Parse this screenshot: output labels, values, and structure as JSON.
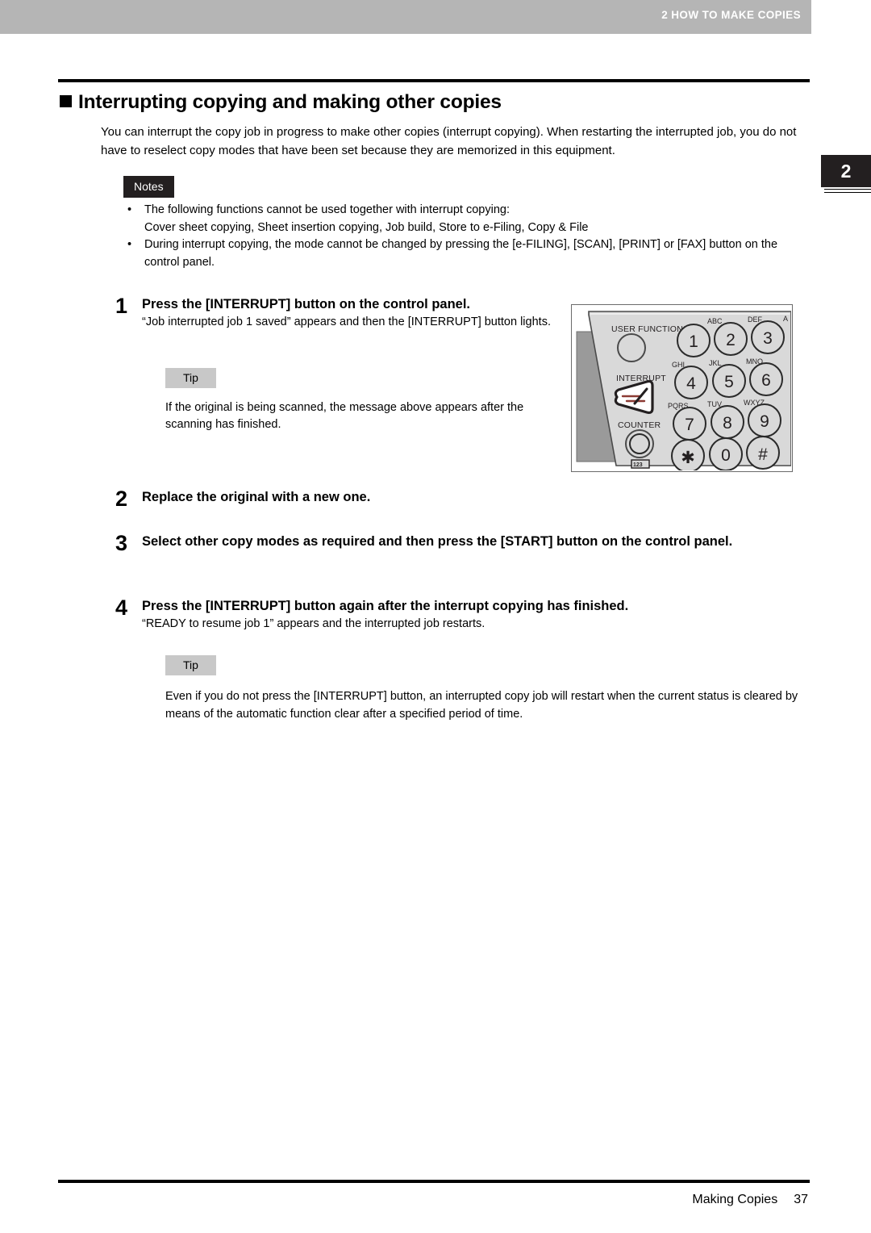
{
  "header": {
    "running_head": "2 HOW TO MAKE COPIES",
    "chapter_tab": "2"
  },
  "section": {
    "title": "Interrupting copying and making other copies",
    "intro": "You can interrupt the copy job in progress to make other copies (interrupt copying). When restarting the interrupted job, you do not have to reselect copy modes that have been set because they are memorized in this equipment."
  },
  "notes": {
    "badge_label": "Notes",
    "bullet_glyph": "•",
    "items": [
      "The following functions cannot be used together with interrupt copying:\nCover sheet copying, Sheet insertion copying, Job build, Store to e-Filing, Copy & File",
      "During interrupt copying, the mode cannot be changed by pressing the [e-FILING], [SCAN], [PRINT] or [FAX] button on the control panel."
    ],
    "item_1_line_1": "The following functions cannot be used together with interrupt copying:",
    "item_1_line_2": "Cover sheet copying, Sheet insertion copying, Job build, Store to e-Filing, Copy & File",
    "item_2": "During interrupt copying, the mode cannot be changed by pressing the [e-FILING], [SCAN], [PRINT] or [FAX] button on the control panel."
  },
  "steps": [
    {
      "number": "1",
      "heading": "Press the [INTERRUPT] button on the control panel.",
      "body": "“Job interrupted job 1 saved” appears and then the [INTERRUPT] button lights."
    },
    {
      "number": "2",
      "heading": "Replace the original with a new one.",
      "body": ""
    },
    {
      "number": "3",
      "heading": "Select other copy modes as required and then press the [START] button on the control panel.",
      "body": ""
    },
    {
      "number": "4",
      "heading": "Press the [INTERRUPT] button again after the interrupt copying has finished.",
      "body": "“READY to resume job 1” appears and the interrupted job restarts."
    }
  ],
  "tips": [
    {
      "badge_label": "Tip",
      "text": "If the original is being scanned, the message above appears after the scanning has finished."
    },
    {
      "badge_label": "Tip",
      "text": "Even if you do not press the [INTERRUPT] button, an interrupted copy job will restart when the current status is cleared by means of the automatic function clear after a specified period of time."
    }
  ],
  "control_panel": {
    "labels": {
      "user_functions": "USER FUNCTIONS",
      "interrupt": "INTERRUPT",
      "counter": "COUNTER",
      "counter_badge": "123"
    },
    "keypad": [
      {
        "digit": "1",
        "letters": ""
      },
      {
        "digit": "2",
        "letters": "ABC"
      },
      {
        "digit": "3",
        "letters": "DEF"
      },
      {
        "digit": "4",
        "letters": "GHI"
      },
      {
        "digit": "5",
        "letters": "JKL"
      },
      {
        "digit": "6",
        "letters": "MNO"
      },
      {
        "digit": "7",
        "letters": "PQRS"
      },
      {
        "digit": "8",
        "letters": "TUV"
      },
      {
        "digit": "9",
        "letters": "WXYZ"
      },
      {
        "digit": "✱",
        "letters": ""
      },
      {
        "digit": "0",
        "letters": ""
      },
      {
        "digit": "#",
        "letters": ""
      }
    ]
  },
  "footer": {
    "chapter_name": "Making Copies",
    "page_number": "37"
  },
  "colors": {
    "header_bar": "#b5b5b5",
    "badge_notes_bg": "#231f20",
    "badge_tip_bg": "#c8c8c8",
    "panel_face": "#d9d9d9",
    "panel_side": "#9a9a9a",
    "rule": "#000000"
  }
}
